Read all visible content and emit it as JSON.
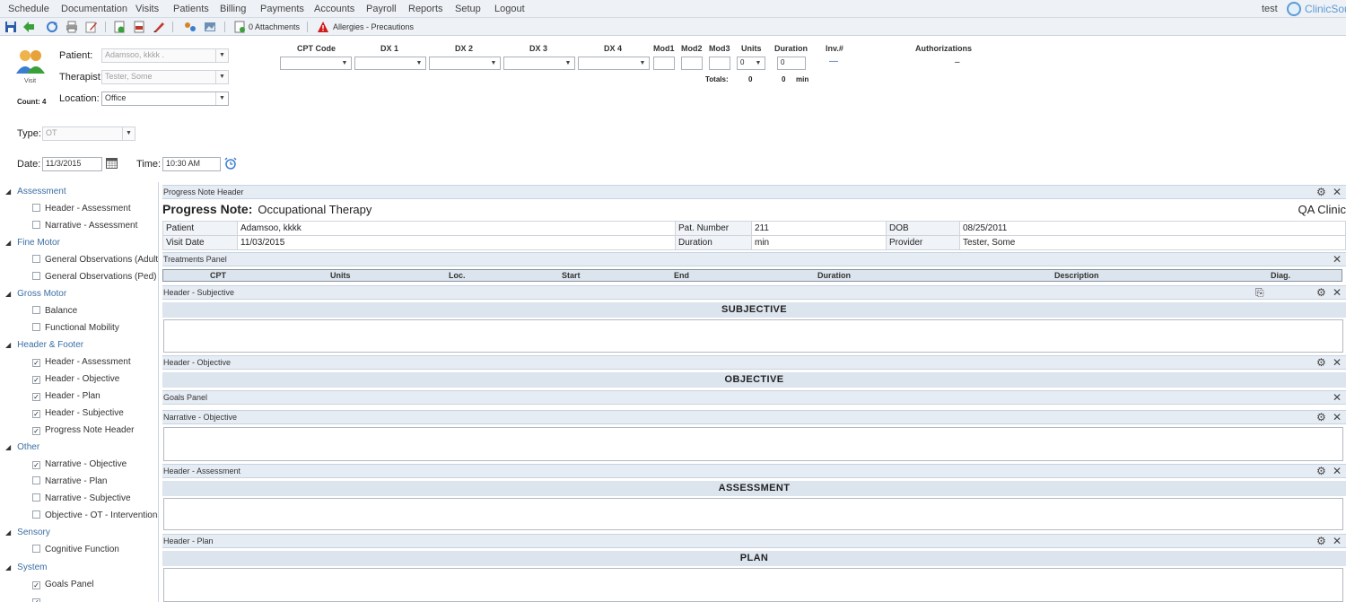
{
  "menu": {
    "items": [
      "Schedule",
      "Documentation",
      "Visits",
      "Patients",
      "Billing",
      "Payments",
      "Accounts",
      "Payroll",
      "Reports",
      "Setup",
      "Logout"
    ],
    "user": "test",
    "brand": "ClinicSou"
  },
  "toolbar": {
    "attachments": "0 Attachments",
    "allergies": "Allergies - Precautions"
  },
  "visit": {
    "icon_label": "Visit",
    "count": "Count: 4",
    "patient_label": "Patient:",
    "patient_value": "Adamsoo, kkkk .",
    "therapist_label": "Therapist:",
    "therapist_value": "Tester, Some",
    "location_label": "Location:",
    "location_value": "Office",
    "type_label": "Type:",
    "type_value": "OT",
    "date_label": "Date:",
    "date_value": "11/3/2015",
    "time_label": "Time:",
    "time_value": "10:30 AM"
  },
  "billing": {
    "headers": [
      "CPT Code",
      "DX 1",
      "DX 2",
      "DX 3",
      "DX 4",
      "Mod1",
      "Mod2",
      "Mod3",
      "Units",
      "Duration",
      "Inv.#",
      "Authorizations"
    ],
    "units_value": "0",
    "duration_value": "0",
    "inv_value": "—",
    "auth_value": "–",
    "totals_label": "Totals:",
    "totals_units": "0",
    "totals_duration": "0",
    "totals_unit": "min"
  },
  "sidebar": {
    "categories": [
      {
        "label": "Assessment",
        "items": [
          {
            "label": "Header - Assessment",
            "checked": false
          },
          {
            "label": "Narrative - Assessment",
            "checked": false
          }
        ]
      },
      {
        "label": "Fine Motor",
        "items": [
          {
            "label": "General Observations (Adult) -",
            "checked": false
          },
          {
            "label": "General Observations (Ped) - F",
            "checked": false
          }
        ]
      },
      {
        "label": "Gross Motor",
        "items": [
          {
            "label": "Balance",
            "checked": false
          },
          {
            "label": "Functional Mobility",
            "checked": false
          }
        ]
      },
      {
        "label": "Header & Footer",
        "items": [
          {
            "label": "Header - Assessment",
            "checked": true
          },
          {
            "label": "Header - Objective",
            "checked": true
          },
          {
            "label": "Header - Plan",
            "checked": true
          },
          {
            "label": "Header - Subjective",
            "checked": true
          },
          {
            "label": "Progress Note Header",
            "checked": true
          }
        ]
      },
      {
        "label": "Other",
        "items": [
          {
            "label": "Narrative - Objective",
            "checked": true
          },
          {
            "label": "Narrative - Plan",
            "checked": false
          },
          {
            "label": "Narrative - Subjective",
            "checked": false
          },
          {
            "label": "Objective - OT - Interventions",
            "checked": false
          }
        ]
      },
      {
        "label": "Sensory",
        "items": [
          {
            "label": "Cognitive Function",
            "checked": false
          }
        ]
      },
      {
        "label": "System",
        "items": [
          {
            "label": "Goals Panel",
            "checked": true
          }
        ]
      }
    ]
  },
  "note": {
    "header_panel": "Progress Note Header",
    "title_bold": "Progress Note:",
    "title_rest": "Occupational Therapy",
    "clinic": "QA Clinic",
    "row1": [
      "Patient",
      "Adamsoo, kkkk",
      "Pat. Number",
      "211",
      "DOB",
      "08/25/2011"
    ],
    "row2": [
      "Visit Date",
      "11/03/2015",
      "Duration",
      " min",
      "Provider",
      "Tester, Some"
    ],
    "treatments_panel": "Treatments Panel",
    "treatments_headers": [
      "CPT",
      "Units",
      "Loc.",
      "Start",
      "End",
      "Duration",
      "Description",
      "Diag."
    ],
    "subjective_panel": "Header - Subjective",
    "subjective_title": "SUBJECTIVE",
    "objective_panel": "Header - Objective",
    "objective_title": "OBJECTIVE",
    "goals_panel": "Goals Panel",
    "narrative_objective_panel": "Narrative - Objective",
    "assessment_panel": "Header - Assessment",
    "assessment_title": "ASSESSMENT",
    "plan_panel": "Header - Plan",
    "plan_title": "PLAN"
  }
}
